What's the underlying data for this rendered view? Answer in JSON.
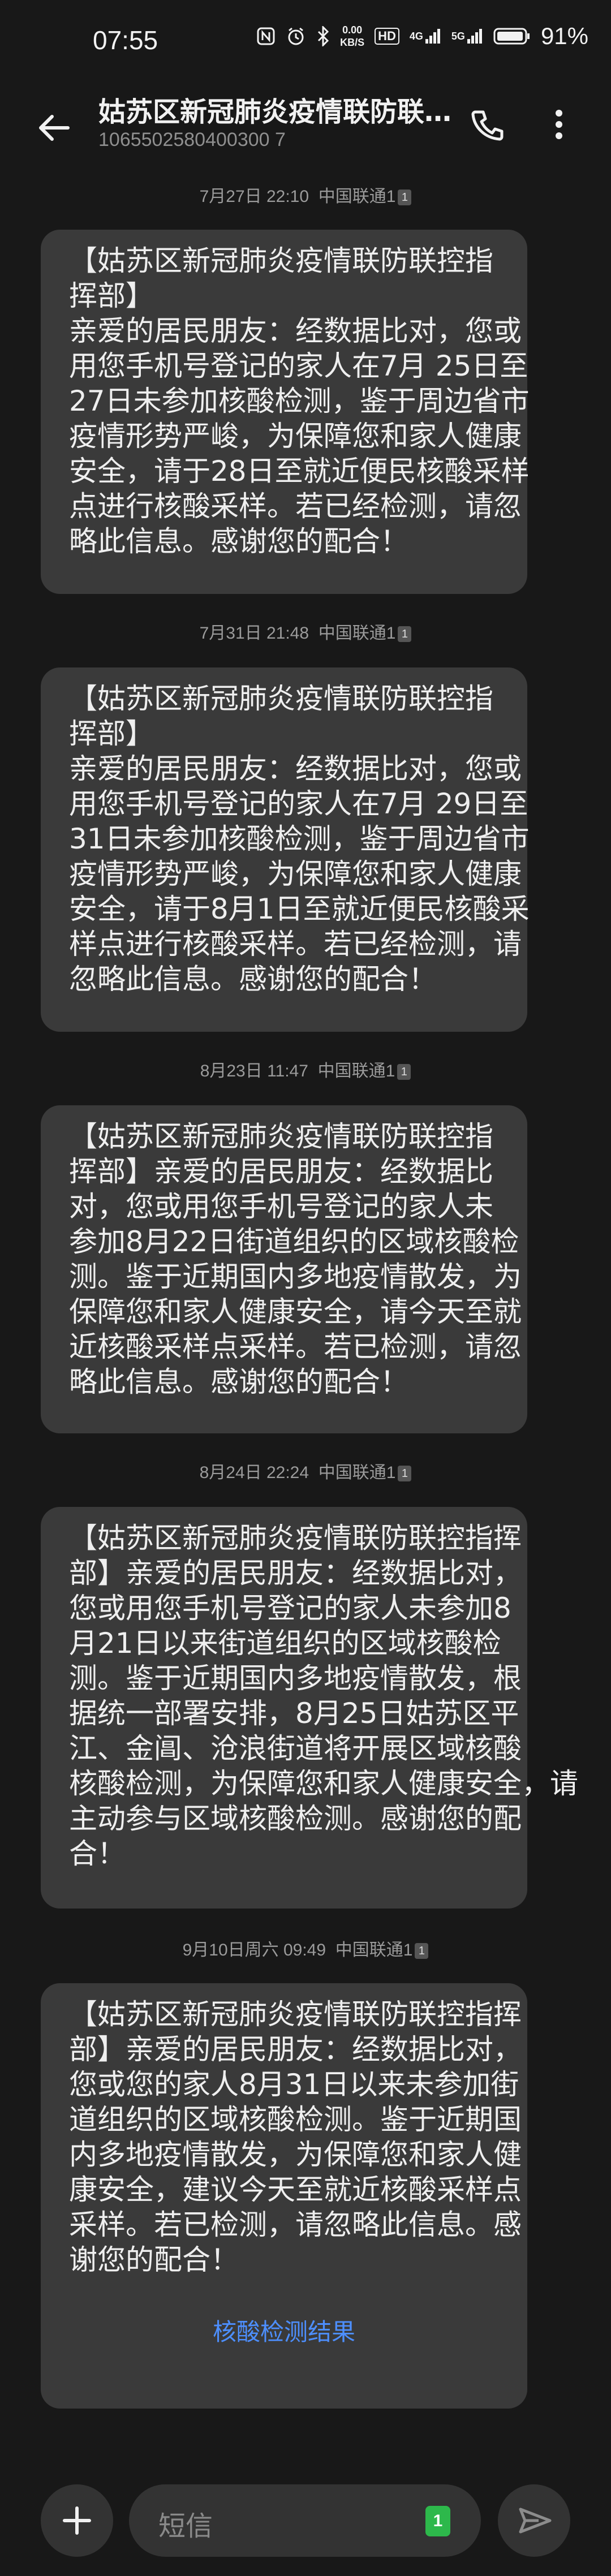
{
  "status_bar": {
    "time": "07:55",
    "speed_top": "0.00",
    "speed_bottom": "KB/S",
    "hd": "HD",
    "signal1": "4G",
    "signal2": "5G",
    "battery": "91%"
  },
  "header": {
    "title": "姑苏区新冠肺炎疫情联防联控指挥部",
    "number": "1065502580400300 7",
    "icons": [
      "back-arrow-icon",
      "phone-icon",
      "more-vert-icon"
    ]
  },
  "messages": [
    {
      "time": "7月27日 22:10",
      "carrier": "中国联通1",
      "sim": "1",
      "lines": [
        "【姑苏区新冠肺炎疫情联防联控指",
        "挥部】",
        "亲爱的居民朋友：经数据比对，您或",
        "用您手机号登记的家人在7月 25日至",
        "27日未参加核酸检测，鉴于周边省市",
        "疫情形势严峻，为保障您和家人健康",
        "安全，请于28日至就近便民核酸采样",
        "点进行核酸采样。若已经检测，请忽",
        "略此信息。感谢您的配合！"
      ]
    },
    {
      "time": "7月31日 21:48",
      "carrier": "中国联通1",
      "sim": "1",
      "lines": [
        "【姑苏区新冠肺炎疫情联防联控指",
        "挥部】",
        "亲爱的居民朋友：经数据比对，您或",
        "用您手机号登记的家人在7月 29日至",
        "31日未参加核酸检测，鉴于周边省市",
        "疫情形势严峻，为保障您和家人健康",
        "安全，请于8月1日至就近便民核酸采",
        "样点进行核酸采样。若已经检测，请",
        "忽略此信息。感谢您的配合！"
      ]
    },
    {
      "time": "8月23日 11:47",
      "carrier": "中国联通1",
      "sim": "1",
      "lines": [
        "【姑苏区新冠肺炎疫情联防联控指",
        "挥部】亲爱的居民朋友：经数据比",
        "对，您或用您手机号登记的家人未",
        "参加8月22日街道组织的区域核酸检",
        "测。鉴于近期国内多地疫情散发，为",
        "保障您和家人健康安全，请今天至就",
        "近核酸采样点采样。若已检测，请忽",
        "略此信息。感谢您的配合！"
      ]
    },
    {
      "time": "8月24日 22:24",
      "carrier": "中国联通1",
      "sim": "1",
      "lines": [
        "【姑苏区新冠肺炎疫情联防联控指挥",
        "部】亲爱的居民朋友：经数据比对，",
        "您或用您手机号登记的家人未参加8",
        "月21日以来街道组织的区域核酸检",
        "测。鉴于近期国内多地疫情散发，根",
        "据统一部署安排，8月25日姑苏区平",
        "江、金阊、沧浪街道将开展区域核酸",
        "核酸检测，为保障您和家人健康安全，请",
        "主动参与区域核酸检测。感谢您的配",
        "合！"
      ]
    },
    {
      "time": "9月10日周六 09:49",
      "carrier": "中国联通1",
      "sim": "1",
      "lines": [
        "【姑苏区新冠肺炎疫情联防联控指挥",
        "部】亲爱的居民朋友：经数据比对，",
        "您或您的家人8月31日以来未参加街",
        "道组织的区域核酸检测。鉴于近期国",
        "内多地疫情散发，为保障您和家人健",
        "康安全，建议今天至就近核酸采样点",
        "采样。若已检测，请忽略此信息。感",
        "谢您的配合！"
      ],
      "link": "核酸检测结果"
    }
  ],
  "input": {
    "placeholder": "短信",
    "sim": "1"
  },
  "colors": {
    "background": "#181818",
    "bubble": "#3a3a3a",
    "link": "#4d8fff",
    "sim_green": "#2db84b"
  }
}
